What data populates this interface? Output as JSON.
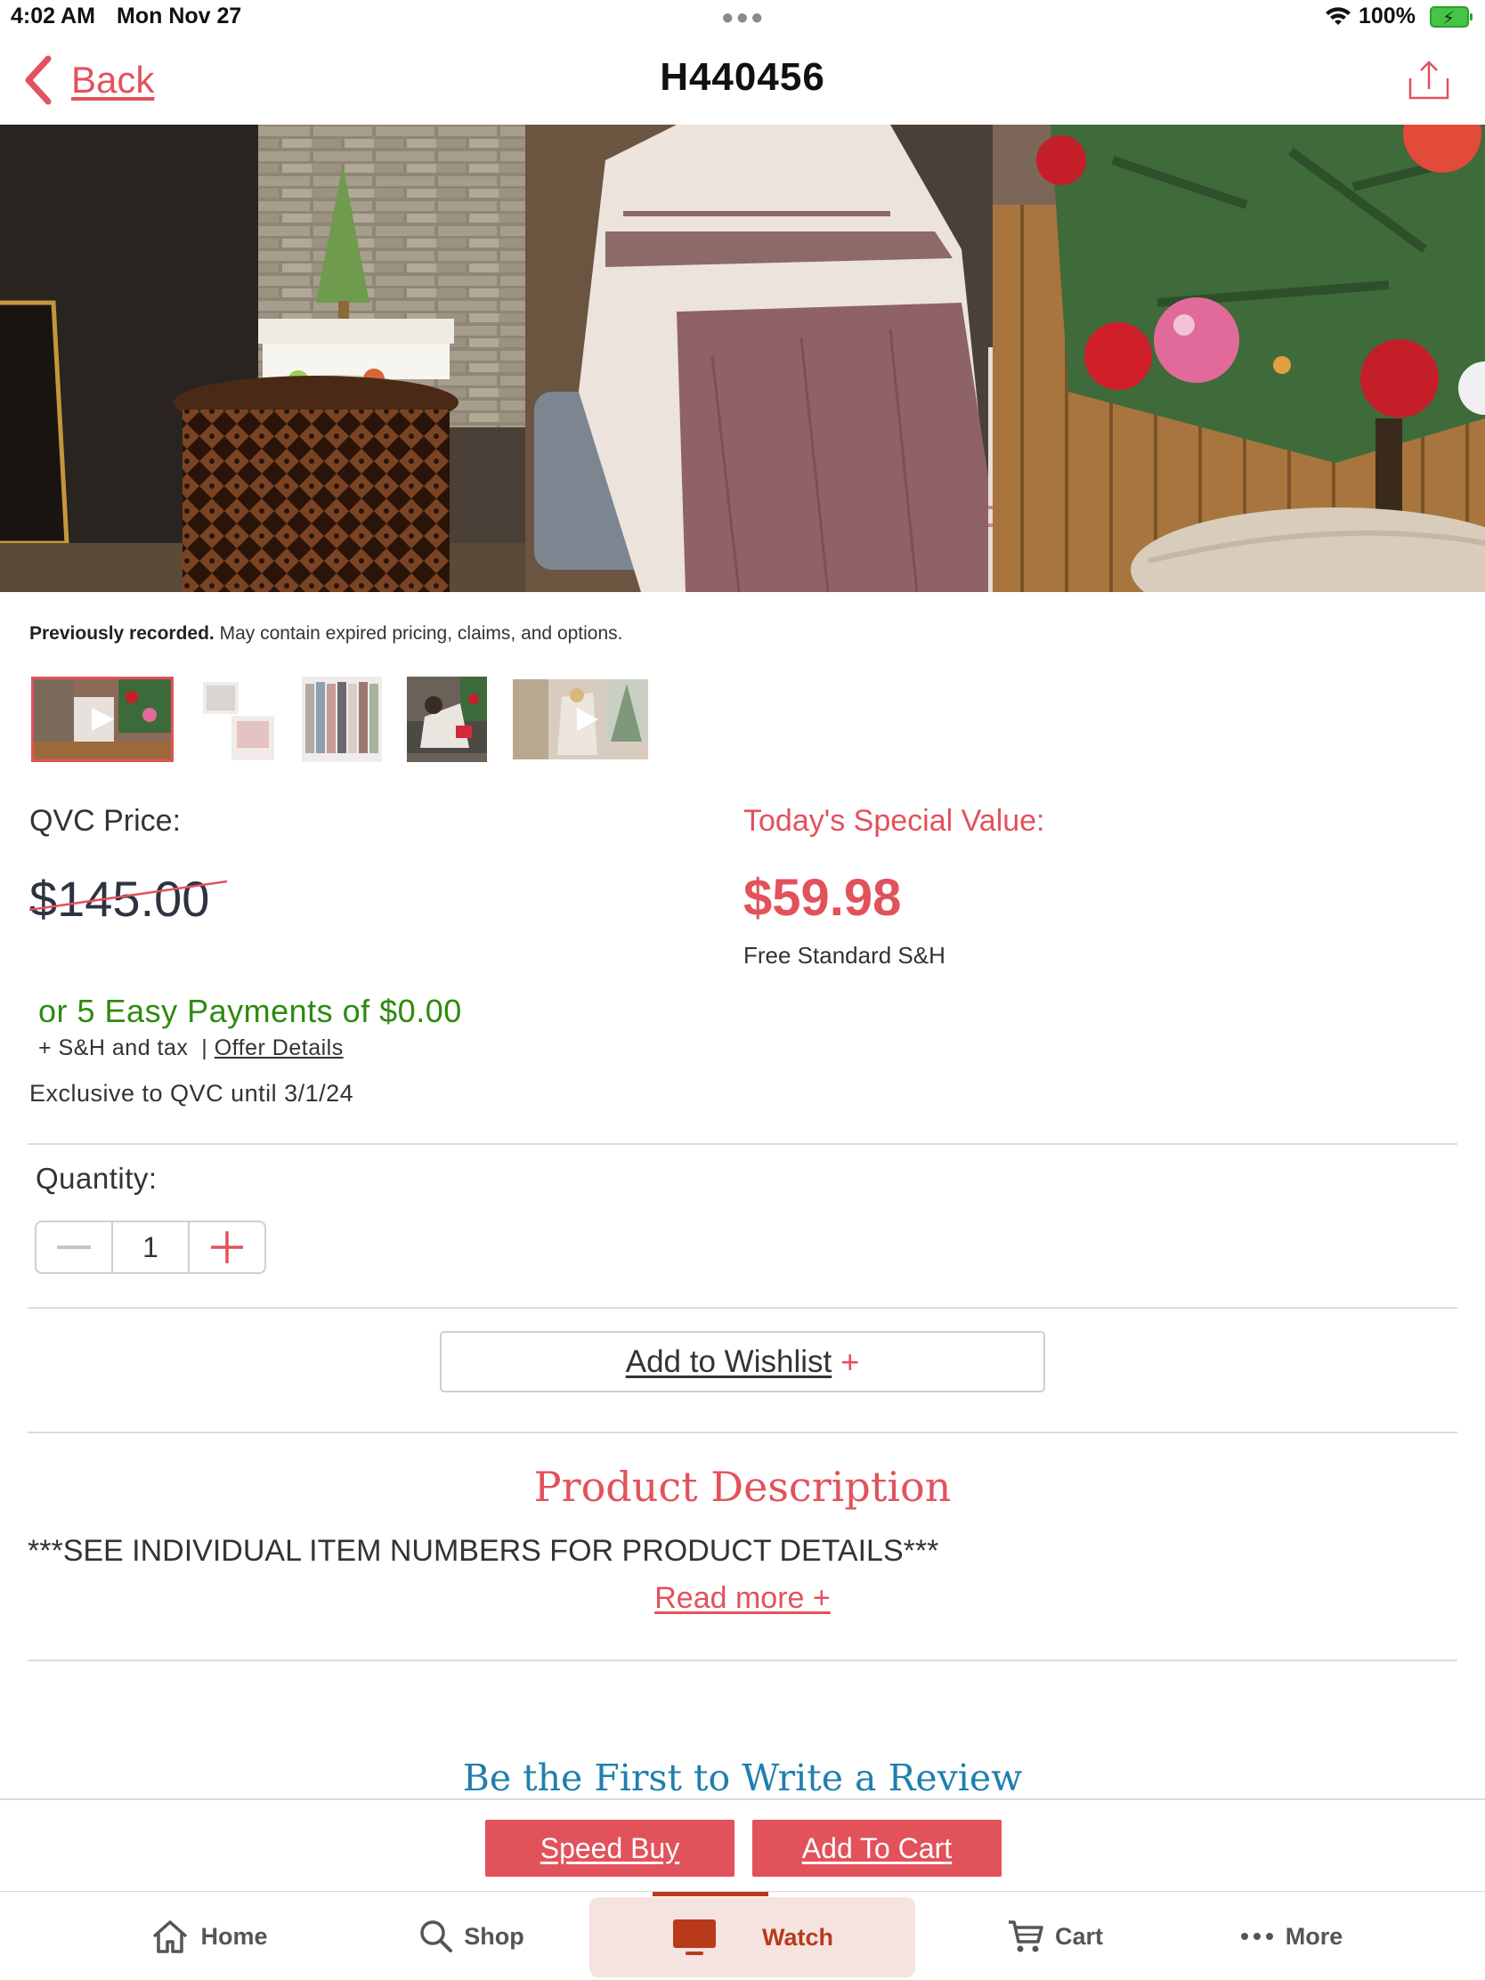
{
  "status_bar": {
    "time": "4:02 AM",
    "date": "Mon Nov 27",
    "battery": "100%"
  },
  "nav": {
    "back_label": "Back",
    "title": "H440456"
  },
  "recorded_note": {
    "bold": "Previously recorded.",
    "text": " May contain expired pricing, claims, and options."
  },
  "thumbnails": [
    {
      "name": "thumb-video-1",
      "type": "video",
      "selected": true
    },
    {
      "name": "thumb-image-1",
      "type": "image",
      "selected": false
    },
    {
      "name": "thumb-image-2",
      "type": "image",
      "selected": false
    },
    {
      "name": "thumb-image-3",
      "type": "image",
      "selected": false
    },
    {
      "name": "thumb-video-2",
      "type": "video",
      "selected": false
    }
  ],
  "pricing": {
    "qvc_label": "QVC Price:",
    "qvc_price": "$145.00",
    "tsv_label": "Today's Special Value:",
    "tsv_price": "$59.98",
    "shipping": "Free Standard S&H",
    "easy_pay": "or 5 Easy Payments of $0.00",
    "sh_tax": "+ S&H and tax  | ",
    "offer_link": "Offer Details",
    "exclusive": "Exclusive to QVC until 3/1/24"
  },
  "quantity": {
    "label": "Quantity:",
    "value": "1"
  },
  "wishlist": {
    "label": "Add to Wishlist",
    "plus": "+"
  },
  "description": {
    "title": "Product Description",
    "text": "***SEE INDIVIDUAL ITEM NUMBERS FOR PRODUCT DETAILS***",
    "read_more": "Read more +"
  },
  "reviews": {
    "title": "Be the First to Write a Review"
  },
  "actions": {
    "speed_buy": "Speed Buy",
    "add_to_cart": "Add To Cart"
  },
  "tab_bar": {
    "items": [
      {
        "label": "Home",
        "icon": "home-icon"
      },
      {
        "label": "Shop",
        "icon": "search-icon"
      },
      {
        "label": "Watch",
        "icon": "tv-icon",
        "active": true
      },
      {
        "label": "Cart",
        "icon": "cart-icon"
      },
      {
        "label": "More",
        "icon": "more-icon"
      }
    ]
  },
  "colors": {
    "accent": "#e2525b",
    "green": "#2f8a0f",
    "review_blue": "#1f7fae",
    "watch_active": "#b83a1b"
  }
}
